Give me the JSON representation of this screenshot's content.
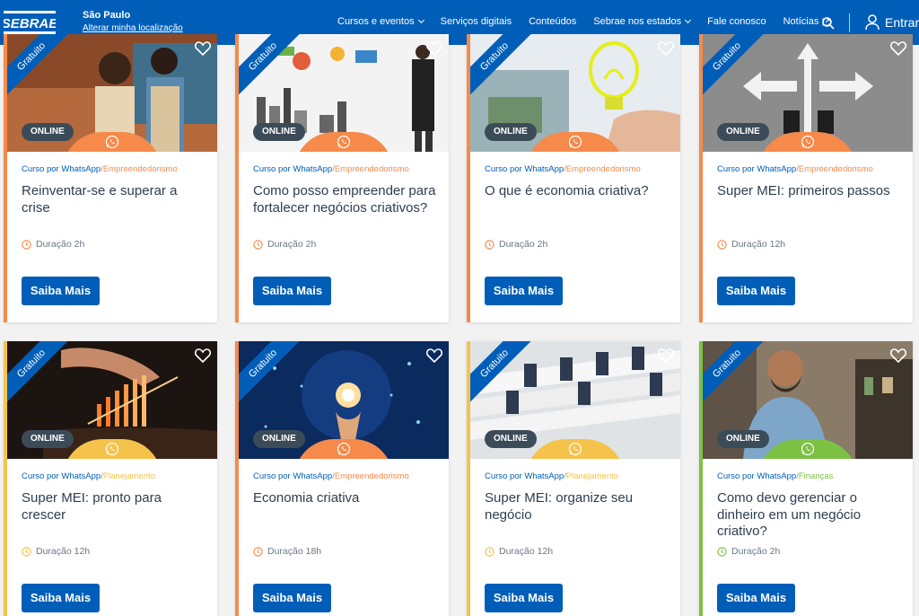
{
  "header": {
    "logo_text": "SEBRAE",
    "location": {
      "city": "São Paulo",
      "change_label": "Alterar minha localização"
    },
    "nav": [
      {
        "label": "Cursos e eventos",
        "icon": "chevron-down-icon"
      },
      {
        "label": "Serviços digitais"
      },
      {
        "label": "Conteúdos"
      },
      {
        "label": "Sebrae nos estados",
        "icon": "chevron-down-icon"
      },
      {
        "label": "Fale conosco"
      },
      {
        "label": "Notícias",
        "icon": "external-link-icon"
      }
    ],
    "search_icon": "search-icon",
    "login_label": "Entrar",
    "bg_color": "#005eb8"
  },
  "colors": {
    "brand_blue": "#005eb8",
    "empreendedorismo": "#f58a4b",
    "planejamento": "#f5c34b",
    "financas": "#7cc143"
  },
  "cards": [
    {
      "ribbon": "Gratuito",
      "badge": "ONLINE",
      "channel": "Curso por WhatsApp",
      "separator": "/",
      "category": "Empreendedorismo",
      "title": "Reinventar-se e superar a crise",
      "duration": "Duração 2h",
      "button": "Saiba Mais"
    },
    {
      "ribbon": "Gratuito",
      "badge": "ONLINE",
      "channel": "Curso por WhatsApp",
      "separator": "/",
      "category": "Empreendedorismo",
      "title": "Como posso empreender para fortalecer negócios criativos?",
      "duration": "Duração 2h",
      "button": "Saiba Mais"
    },
    {
      "ribbon": "Gratuito",
      "badge": "ONLINE",
      "channel": "Curso por WhatsApp",
      "separator": "/",
      "category": "Empreendedorismo",
      "title": "O que é economia criativa?",
      "duration": "Duração 2h",
      "button": "Saiba Mais"
    },
    {
      "ribbon": "Gratuito",
      "badge": "ONLINE",
      "channel": "Curso por WhatsApp",
      "separator": "/",
      "category": "Empreendedorismo",
      "title": "Super MEI: primeiros passos",
      "duration": "Duração 12h",
      "button": "Saiba Mais"
    },
    {
      "ribbon": "Gratuito",
      "badge": "ONLINE",
      "channel": "Curso por WhatsApp",
      "separator": "/",
      "category": "Planejamento",
      "title": "Super MEI: pronto para crescer",
      "duration": "Duração 12h",
      "button": "Saiba Mais"
    },
    {
      "ribbon": "Gratuito",
      "badge": "ONLINE",
      "channel": "Curso por WhatsApp",
      "separator": "/",
      "category": "Empreendedorismo",
      "title": "Economia criativa",
      "duration": "Duração 18h",
      "button": "Saiba Mais"
    },
    {
      "ribbon": "Gratuito",
      "badge": "ONLINE",
      "channel": "Curso por WhatsApp",
      "separator": "/",
      "category": "Planejamento",
      "title": "Super MEI: organize seu negócio",
      "duration": "Duração 12h",
      "button": "Saiba Mais"
    },
    {
      "ribbon": "Gratuito",
      "badge": "ONLINE",
      "channel": "Curso por WhatsApp",
      "separator": "/",
      "category": "Finanças",
      "title": "Como devo gerenciar o dinheiro em um negócio criativo?",
      "duration": "Duração 2h",
      "button": "Saiba Mais"
    }
  ]
}
